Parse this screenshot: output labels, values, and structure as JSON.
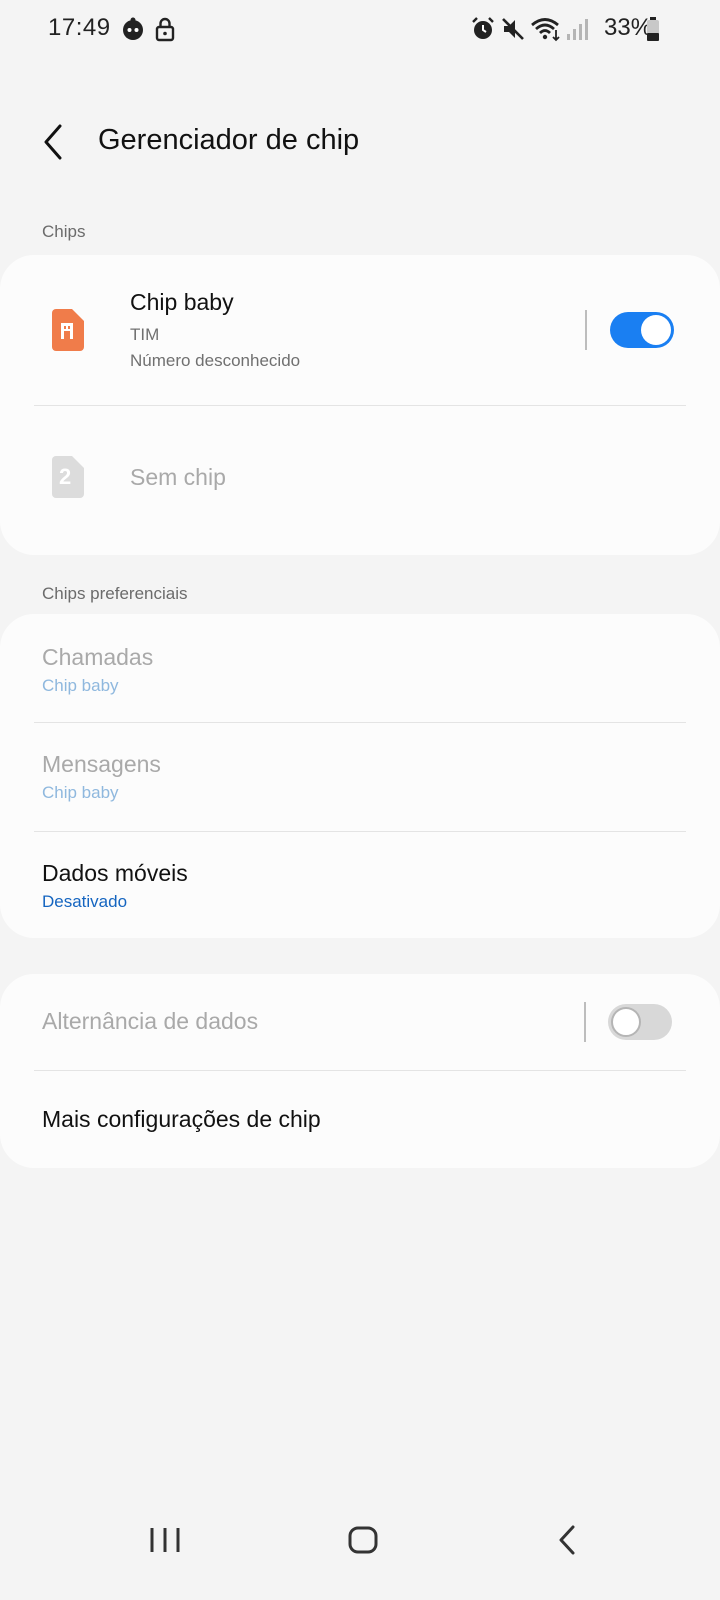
{
  "status_bar": {
    "time": "17:49",
    "battery": "33%",
    "icons": [
      "face-icon",
      "lock-icon",
      "alarm-icon",
      "mute-icon",
      "wifi-icon",
      "signal-icon",
      "battery-icon"
    ]
  },
  "header": {
    "title": "Gerenciador de chip"
  },
  "chips_section": {
    "label": "Chips",
    "sim1": {
      "name": "Chip baby",
      "carrier": "TIM",
      "number": "Número desconhecido",
      "enabled": true,
      "icon_color": "#f07c4a"
    },
    "sim2": {
      "name": "Sem chip",
      "slot_number": "2"
    }
  },
  "preferred_section": {
    "label": "Chips preferenciais",
    "items": [
      {
        "title": "Chamadas",
        "value": "Chip baby"
      },
      {
        "title": "Mensagens",
        "value": "Chip baby"
      },
      {
        "title": "Dados móveis",
        "value": "Desativado"
      }
    ]
  },
  "more_section": {
    "data_switch": {
      "label": "Alternância de dados",
      "enabled": false
    },
    "more_settings": {
      "label": "Mais configurações de chip"
    }
  },
  "colors": {
    "accent": "#1a7ff2",
    "background": "#f4f4f4",
    "card": "#fcfcfc"
  }
}
